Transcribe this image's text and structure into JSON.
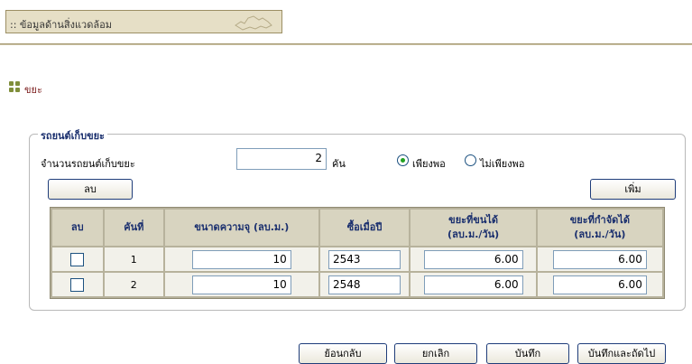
{
  "header": {
    "title": ":: ข้อมูลด้านสิ่งแวดล้อม"
  },
  "section": {
    "label": "ขยะ"
  },
  "panel": {
    "legend": "รถยนต์เก็บขยะ",
    "count_label": "จำนวนรถยนต์เก็บขยะ",
    "count_value": "2",
    "count_unit": "คัน",
    "radio_enough": "เพียงพอ",
    "radio_not_enough": "ไม่เพียงพอ",
    "selected": "enough",
    "delete_button": "ลบ",
    "add_button": "เพิ่ม"
  },
  "table": {
    "headers": {
      "delete": "ลบ",
      "no": "คันที่",
      "size": "ขนาดความจุ (ลบ.ม.)",
      "year": "ซื้อเมื่อปี",
      "transported_1": "ขยะที่ขนได้",
      "transported_2": "(ลบ.ม./วัน)",
      "disposed_1": "ขยะที่กำจัดได้",
      "disposed_2": "(ลบ.ม./วัน)"
    },
    "rows": [
      {
        "no": "1",
        "size": "10",
        "year": "2543",
        "transported": "6.00",
        "disposed": "6.00"
      },
      {
        "no": "2",
        "size": "10",
        "year": "2548",
        "transported": "6.00",
        "disposed": "6.00"
      }
    ]
  },
  "footer": {
    "back_button": "ย้อนกลับ",
    "cancel_button": "ยกเลิก",
    "save_button": "บันทึก",
    "save_next_button": "บันทึกและถัดไป"
  }
}
